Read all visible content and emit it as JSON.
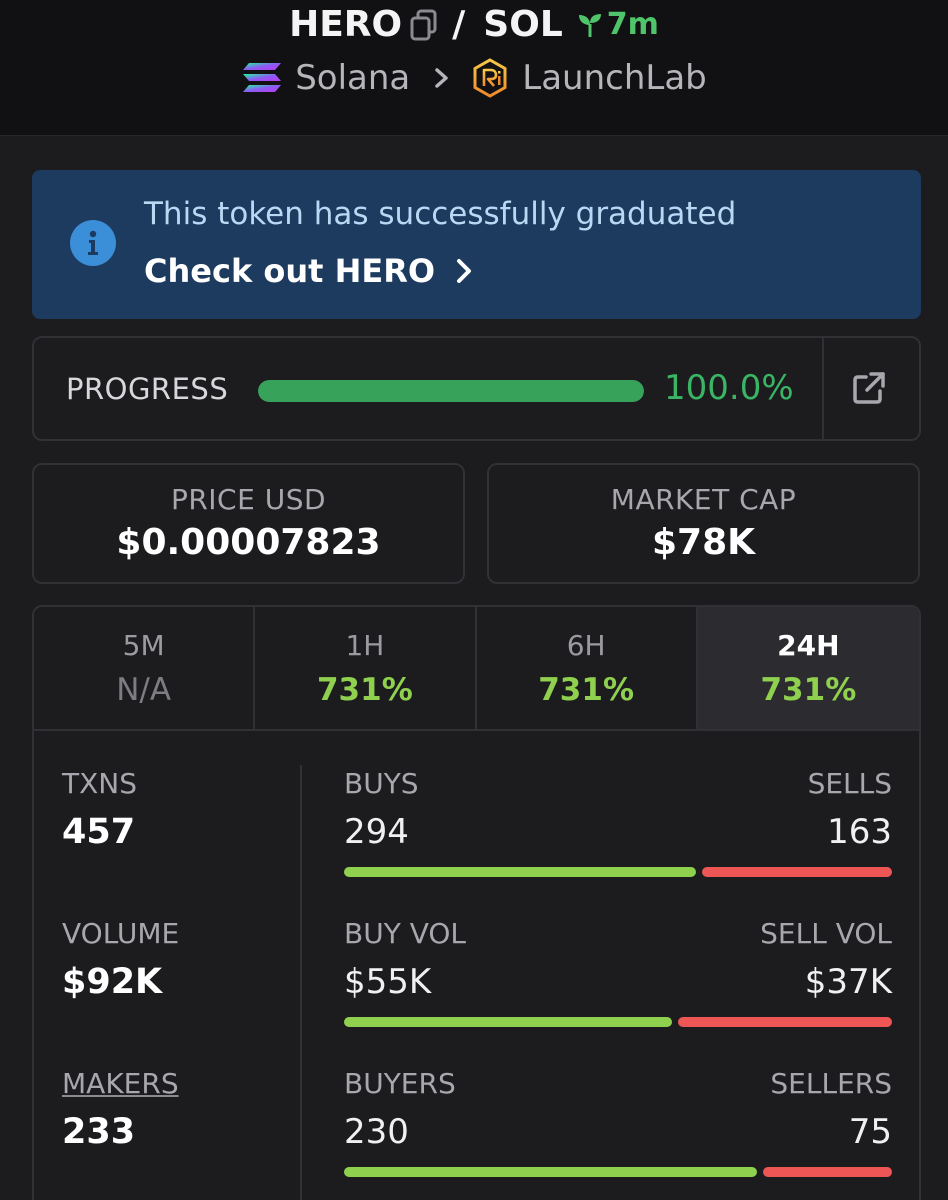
{
  "header": {
    "token_symbol": "HERO",
    "separator": "/",
    "quote_symbol": "SOL",
    "age": "7m",
    "chain": "Solana",
    "dex": "LaunchLab"
  },
  "banner": {
    "message": "This token has successfully graduated",
    "cta": "Check out HERO"
  },
  "progress": {
    "label": "PROGRESS",
    "percent_text": "100.0%",
    "fraction": 1.0
  },
  "price": {
    "label": "PRICE USD",
    "value": "$0.00007823"
  },
  "market_cap": {
    "label": "MARKET CAP",
    "value": "$78K"
  },
  "tabs": [
    {
      "label": "5M",
      "value": "N/A",
      "active": false
    },
    {
      "label": "1H",
      "value": "731%",
      "active": false
    },
    {
      "label": "6H",
      "value": "731%",
      "active": false
    },
    {
      "label": "24H",
      "value": "731%",
      "active": true
    }
  ],
  "stats": {
    "txns": {
      "label": "TXNS",
      "value": "457"
    },
    "volume": {
      "label": "VOLUME",
      "value": "$92K"
    },
    "makers": {
      "label": "MAKERS",
      "value": "233"
    },
    "buys": {
      "label": "BUYS",
      "value": "294",
      "share": 0.643
    },
    "sells": {
      "label": "SELLS",
      "value": "163"
    },
    "buy_vol": {
      "label": "BUY VOL",
      "value": "$55K",
      "share": 0.598
    },
    "sell_vol": {
      "label": "SELL VOL",
      "value": "$37K"
    },
    "buyers": {
      "label": "BUYERS",
      "value": "230",
      "share": 0.754
    },
    "sellers": {
      "label": "SELLERS",
      "value": "75"
    }
  },
  "colors": {
    "accent_green": "#3ab565",
    "change_green": "#8fd14f",
    "sell_red": "#ee5656",
    "banner_bg": "#1d3a5f"
  }
}
